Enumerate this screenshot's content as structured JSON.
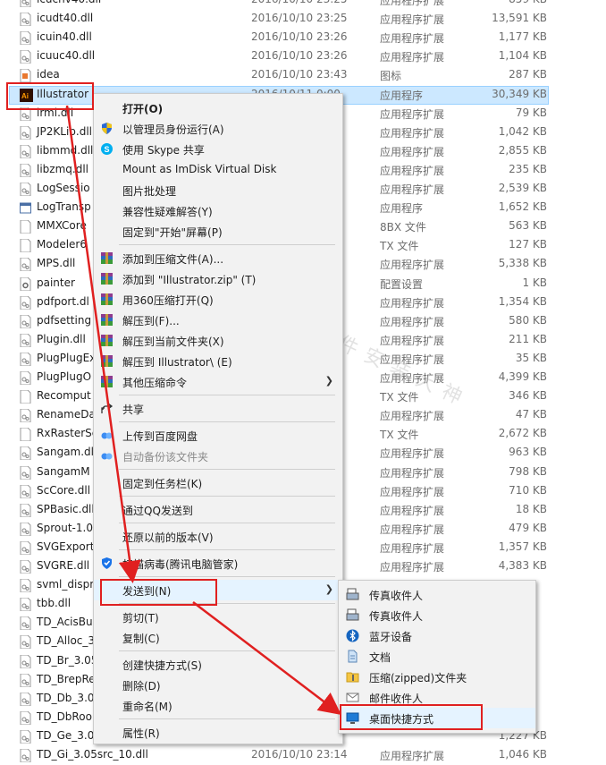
{
  "files": [
    {
      "name": "icucnv40.dll",
      "date": "2016/10/10 23:25",
      "type": "应用程序扩展",
      "size": "859 KB",
      "icon": "dll-icon"
    },
    {
      "name": "icudt40.dll",
      "date": "2016/10/10 23:25",
      "type": "应用程序扩展",
      "size": "13,591 KB",
      "icon": "dll-icon"
    },
    {
      "name": "icuin40.dll",
      "date": "2016/10/10 23:26",
      "type": "应用程序扩展",
      "size": "1,177 KB",
      "icon": "dll-icon"
    },
    {
      "name": "icuuc40.dll",
      "date": "2016/10/10 23:26",
      "type": "应用程序扩展",
      "size": "1,104 KB",
      "icon": "dll-icon"
    },
    {
      "name": "idea",
      "date": "2016/10/10 23:43",
      "type": "图标",
      "size": "287 KB",
      "icon": "ico-icon"
    },
    {
      "name": "Illustrator",
      "date": "2016/10/11 0:00",
      "type": "应用程序",
      "size": "30,349 KB",
      "icon": "illustrator-app-icon",
      "selected": true
    },
    {
      "name": "irml.dll",
      "date": "",
      "type": "应用程序扩展",
      "size": "79 KB",
      "icon": "dll-icon"
    },
    {
      "name": "JP2KLib.dll",
      "date": "",
      "type": "应用程序扩展",
      "size": "1,042 KB",
      "icon": "dll-icon"
    },
    {
      "name": "libmmd.dll",
      "date": "",
      "type": "应用程序扩展",
      "size": "2,855 KB",
      "icon": "dll-icon"
    },
    {
      "name": "libzmq.dll",
      "date": "",
      "type": "应用程序扩展",
      "size": "235 KB",
      "icon": "dll-icon"
    },
    {
      "name": "LogSessio",
      "date": "",
      "type": "应用程序扩展",
      "size": "2,539 KB",
      "icon": "dll-icon"
    },
    {
      "name": "LogTransp",
      "date": "",
      "type": "应用程序",
      "size": "1,652 KB",
      "icon": "exe-icon"
    },
    {
      "name": "MMXCore",
      "date": "",
      "type": "8BX 文件",
      "size": "563 KB",
      "icon": "file-icon"
    },
    {
      "name": "Modeler6",
      "date": "",
      "type": "TX 文件",
      "size": "127 KB",
      "icon": "file-icon"
    },
    {
      "name": "MPS.dll",
      "date": "",
      "type": "应用程序扩展",
      "size": "5,338 KB",
      "icon": "dll-icon"
    },
    {
      "name": "painter",
      "date": "",
      "type": "配置设置",
      "size": "1 KB",
      "icon": "settings-file-icon"
    },
    {
      "name": "pdfport.dl",
      "date": "",
      "type": "应用程序扩展",
      "size": "1,354 KB",
      "icon": "dll-icon"
    },
    {
      "name": "pdfsetting",
      "date": "",
      "type": "应用程序扩展",
      "size": "580 KB",
      "icon": "dll-icon"
    },
    {
      "name": "Plugin.dll",
      "date": "",
      "type": "应用程序扩展",
      "size": "211 KB",
      "icon": "dll-icon"
    },
    {
      "name": "PlugPlugEx",
      "date": "",
      "type": "应用程序扩展",
      "size": "35 KB",
      "icon": "dll-icon"
    },
    {
      "name": "PlugPlugO",
      "date": "",
      "type": "应用程序扩展",
      "size": "4,399 KB",
      "icon": "dll-icon"
    },
    {
      "name": "Recomput",
      "date": "",
      "type": "TX 文件",
      "size": "346 KB",
      "icon": "file-icon"
    },
    {
      "name": "RenameDa",
      "date": "",
      "type": "应用程序扩展",
      "size": "47 KB",
      "icon": "dll-icon"
    },
    {
      "name": "RxRasterSe",
      "date": "",
      "type": "TX 文件",
      "size": "2,672 KB",
      "icon": "file-icon"
    },
    {
      "name": "Sangam.dll",
      "date": "",
      "type": "应用程序扩展",
      "size": "963 KB",
      "icon": "dll-icon"
    },
    {
      "name": "SangamM",
      "date": "",
      "type": "应用程序扩展",
      "size": "798 KB",
      "icon": "dll-icon"
    },
    {
      "name": "ScCore.dll",
      "date": "",
      "type": "应用程序扩展",
      "size": "710 KB",
      "icon": "dll-icon"
    },
    {
      "name": "SPBasic.dll",
      "date": "",
      "type": "应用程序扩展",
      "size": "18 KB",
      "icon": "dll-icon"
    },
    {
      "name": "Sprout-1.0",
      "date": "",
      "type": "应用程序扩展",
      "size": "479 KB",
      "icon": "dll-icon"
    },
    {
      "name": "SVGExport",
      "date": "",
      "type": "应用程序扩展",
      "size": "1,357 KB",
      "icon": "dll-icon"
    },
    {
      "name": "SVGRE.dll",
      "date": "",
      "type": "应用程序扩展",
      "size": "4,383 KB",
      "icon": "dll-icon"
    },
    {
      "name": "svml_dispm",
      "date": "",
      "type": "",
      "size": "",
      "icon": "dll-icon"
    },
    {
      "name": "tbb.dll",
      "date": "",
      "type": "",
      "size": "",
      "icon": "dll-icon"
    },
    {
      "name": "TD_AcisBu",
      "date": "",
      "type": "",
      "size": "",
      "icon": "dll-icon"
    },
    {
      "name": "TD_Alloc_3",
      "date": "",
      "type": "",
      "size": "",
      "icon": "dll-icon"
    },
    {
      "name": "TD_Br_3.05",
      "date": "",
      "type": "",
      "size": "",
      "icon": "dll-icon"
    },
    {
      "name": "TD_BrepRe",
      "date": "",
      "type": "",
      "size": "",
      "icon": "dll-icon"
    },
    {
      "name": "TD_Db_3.0",
      "date": "",
      "type": "",
      "size": "",
      "icon": "dll-icon"
    },
    {
      "name": "TD_DbRoo",
      "date": "",
      "type": "",
      "size": "",
      "icon": "dll-icon"
    },
    {
      "name": "TD_Ge_3.0",
      "date": "",
      "type": "",
      "size": "1,227 KB",
      "icon": "dll-icon"
    },
    {
      "name": "TD_Gi_3.05src_10.dll",
      "date": "2016/10/10 23:14",
      "type": "应用程序扩展",
      "size": "1,046 KB",
      "icon": "dll-icon"
    }
  ],
  "context_menu": {
    "items": [
      {
        "label": "打开(O)",
        "icon": "",
        "bold": true
      },
      {
        "label": "以管理员身份运行(A)",
        "icon": "uac-shield-icon"
      },
      {
        "label": "使用 Skype 共享",
        "icon": "skype-icon"
      },
      {
        "label": "Mount as ImDisk Virtual Disk",
        "icon": ""
      },
      {
        "label": "图片批处理",
        "icon": ""
      },
      {
        "label": "兼容性疑难解答(Y)",
        "icon": ""
      },
      {
        "label": "固定到\"开始\"屏幕(P)",
        "icon": ""
      },
      {
        "sep": true
      },
      {
        "label": "添加到压缩文件(A)...",
        "icon": "winrar-icon"
      },
      {
        "label": "添加到 \"Illustrator.zip\" (T)",
        "icon": "winrar-icon"
      },
      {
        "label": "用360压缩打开(Q)",
        "icon": "winrar-icon"
      },
      {
        "label": "解压到(F)...",
        "icon": "winrar-icon"
      },
      {
        "label": "解压到当前文件夹(X)",
        "icon": "winrar-icon"
      },
      {
        "label": "解压到 Illustrator\\ (E)",
        "icon": "winrar-icon"
      },
      {
        "label": "其他压缩命令",
        "icon": "winrar-icon",
        "submenu": true
      },
      {
        "sep": true
      },
      {
        "label": "共享",
        "icon": "share-icon"
      },
      {
        "sep": true
      },
      {
        "label": "上传到百度网盘",
        "icon": "baidu-cloud-icon"
      },
      {
        "label": "自动备份该文件夹",
        "icon": "baidu-cloud-icon",
        "disabled": true
      },
      {
        "sep": true
      },
      {
        "label": "固定到任务栏(K)",
        "icon": ""
      },
      {
        "sep": true
      },
      {
        "label": "通过QQ发送到",
        "icon": ""
      },
      {
        "sep": true
      },
      {
        "label": "还原以前的版本(V)",
        "icon": ""
      },
      {
        "sep": true
      },
      {
        "label": "扫描病毒(腾讯电脑管家)",
        "icon": "tencent-shield-icon"
      },
      {
        "sep": true
      },
      {
        "label": "发送到(N)",
        "icon": "",
        "submenu": true,
        "hover": true
      },
      {
        "sep": true
      },
      {
        "label": "剪切(T)",
        "icon": ""
      },
      {
        "label": "复制(C)",
        "icon": ""
      },
      {
        "sep": true
      },
      {
        "label": "创建快捷方式(S)",
        "icon": ""
      },
      {
        "label": "删除(D)",
        "icon": ""
      },
      {
        "label": "重命名(M)",
        "icon": ""
      },
      {
        "sep": true
      },
      {
        "label": "属性(R)",
        "icon": ""
      }
    ]
  },
  "sendto_menu": {
    "items": [
      {
        "label": "传真收件人",
        "icon": "fax-icon"
      },
      {
        "label": "传真收件人",
        "icon": "fax-icon"
      },
      {
        "label": "蓝牙设备",
        "icon": "bluetooth-icon"
      },
      {
        "label": "文档",
        "icon": "documents-icon"
      },
      {
        "label": "压缩(zipped)文件夹",
        "icon": "zip-folder-icon"
      },
      {
        "label": "邮件收件人",
        "icon": "mail-icon"
      },
      {
        "label": "桌面快捷方式",
        "icon": "desktop-icon",
        "hover": true
      }
    ]
  },
  "watermark": "关注微信公众号：软件安装大神",
  "colors": {
    "selection": "#cce8ff",
    "annotation_red": "#e02020",
    "menu_bg": "#f2f2f2"
  }
}
